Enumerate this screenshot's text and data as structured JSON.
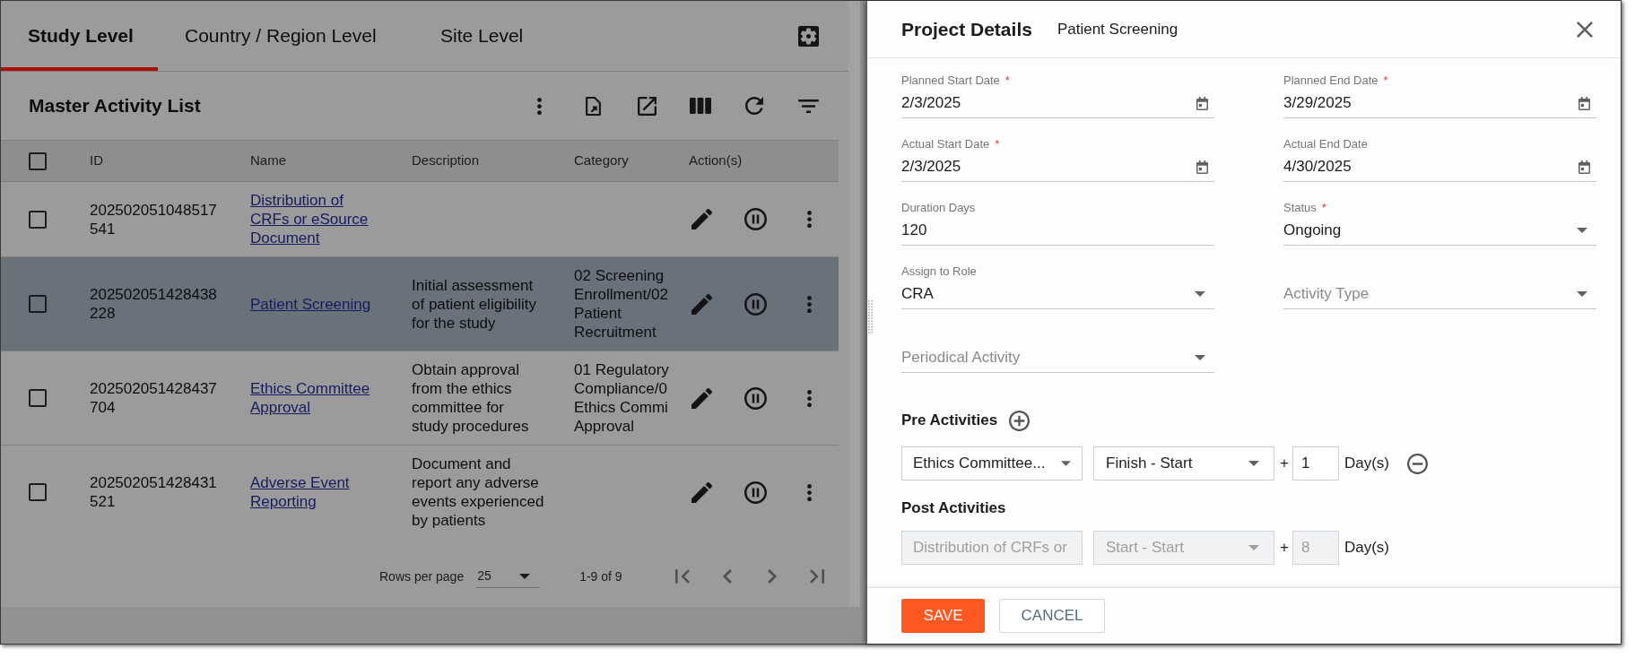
{
  "tabs": [
    {
      "label": "Study Level",
      "selected": true
    },
    {
      "label": "Country / Region Level",
      "selected": false
    },
    {
      "label": "Site Level",
      "selected": false
    }
  ],
  "list": {
    "title": "Master Activity List"
  },
  "table": {
    "header_checkbox": {
      "checked": false
    },
    "columns": [
      "ID",
      "Name",
      "Description",
      "Category",
      "Action(s)"
    ],
    "rows": [
      {
        "checked": false,
        "selected": false,
        "id": "202502051048517541",
        "name": "Distribution of CRFs or eSource Document"
      },
      {
        "checked": false,
        "selected": true,
        "id": "202502051428438228",
        "name": "Patient Screening",
        "description": "Initial assessment\nof patient eligibility\nfor the study",
        "category": "02 Screening\nEnrollment/02\nPatient\nRecruitment"
      },
      {
        "checked": false,
        "selected": false,
        "id": "202502051428437704",
        "name": "Ethics Committee Approval",
        "description": "Obtain approval\nfrom the ethics\ncommittee for\nstudy procedures",
        "category": "01 Regulatory\nCompliance/0\nEthics Commi\nApproval"
      },
      {
        "checked": false,
        "selected": false,
        "id": "202502051428431521",
        "name": "Adverse Event Reporting",
        "description": "Document and\nreport any adverse\nevents experienced\nby patients"
      }
    ]
  },
  "pagination": {
    "rows_per_page_label": "Rows per page",
    "rows_per_page": "25",
    "range": "1-9 of 9",
    "nav_disabled": true
  },
  "panel": {
    "title": "Project Details",
    "subtitle": "Patient Screening",
    "fields": [
      {
        "kind": "date",
        "label": "Planned Start Date",
        "required_mark": "*",
        "value": "2/3/2025"
      },
      {
        "kind": "date",
        "label": "Planned End Date",
        "required_mark": "*",
        "value": "3/29/2025"
      },
      {
        "kind": "date",
        "label": "Actual Start Date",
        "required_mark": "*",
        "value": "2/3/2025"
      },
      {
        "kind": "date",
        "label": "Actual End Date",
        "value": "4/30/2025"
      },
      {
        "kind": "text",
        "label": "Duration Days",
        "value": "120"
      },
      {
        "kind": "select",
        "label": "Status",
        "required_mark": "*",
        "value": "Ongoing"
      },
      {
        "kind": "select",
        "label": "Assign to Role",
        "value": "CRA"
      },
      {
        "kind": "select",
        "placeholder": "Activity Type"
      },
      {
        "kind": "select",
        "placeholder": "Periodical Activity"
      }
    ],
    "pre_activities": {
      "title": "Pre Activities",
      "rows": [
        {
          "disabled": false,
          "removable": true,
          "activity": "Ethics Committee...",
          "relation": "Finish - Start",
          "plus": "+",
          "lag": "1",
          "unit": "Day(s)"
        }
      ]
    },
    "post_activities": {
      "title": "Post Activities",
      "rows": [
        {
          "disabled": true,
          "removable": false,
          "activity": "Distribution of CRFs or",
          "relation": "Start - Start",
          "plus": "+",
          "lag": "8",
          "unit": "Day(s)"
        }
      ]
    },
    "buttons": [
      {
        "kind": "primary",
        "label": "SAVE"
      },
      {
        "kind": "secondary",
        "label": "CANCEL"
      }
    ]
  }
}
